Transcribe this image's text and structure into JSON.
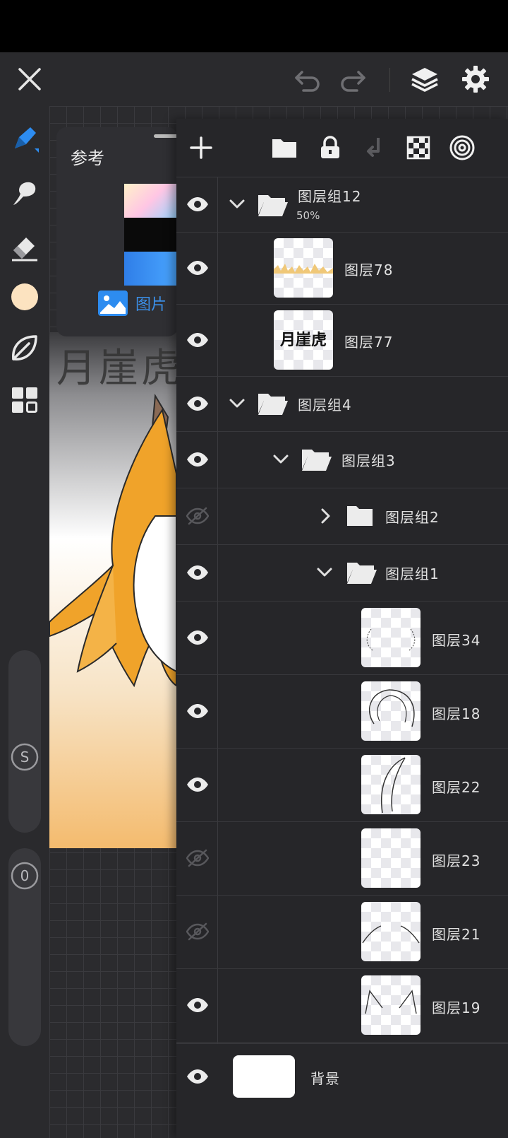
{
  "top_bar": {
    "close_icon": "close-icon",
    "undo_icon": "undo-icon",
    "redo_icon": "redo-icon",
    "layers_icon": "layers-icon",
    "settings_icon": "gear-icon"
  },
  "left_toolbar": {
    "tools": [
      "pen-icon",
      "smudge-icon",
      "eraser-icon",
      "color-swatch",
      "leaf-icon",
      "grid-icon"
    ],
    "active_color": "#FCE3C0",
    "accent_color": "#2D8CF0",
    "size_knob_label": "S",
    "opacity_knob_label": "0"
  },
  "reference_panel": {
    "title": "参考",
    "tab_label": "图片"
  },
  "canvas": {
    "title_text": "月崖虎"
  },
  "layer_toolbar": {
    "icons": [
      "add-icon",
      "folder-icon",
      "lock-icon",
      "merge-down-icon",
      "transparency-icon",
      "target-icon"
    ]
  },
  "layers": [
    {
      "name": "图层组12",
      "opacity": "50%",
      "type": "group",
      "visible": true,
      "expanded": true,
      "level": 0
    },
    {
      "name": "图层78",
      "type": "layer",
      "visible": true,
      "level": 1
    },
    {
      "name": "图层77",
      "type": "layer",
      "visible": true,
      "level": 1,
      "thumb_text": "月崖虎"
    },
    {
      "name": "图层组4",
      "type": "group",
      "visible": true,
      "expanded": true,
      "level": 0
    },
    {
      "name": "图层组3",
      "type": "group",
      "visible": true,
      "expanded": true,
      "level": 1
    },
    {
      "name": "图层组2",
      "type": "group",
      "visible": false,
      "expanded": false,
      "level": 2
    },
    {
      "name": "图层组1",
      "type": "group",
      "visible": true,
      "expanded": true,
      "level": 2
    },
    {
      "name": "图层34",
      "type": "layer",
      "visible": true,
      "level": 3
    },
    {
      "name": "图层18",
      "type": "layer",
      "visible": true,
      "level": 3
    },
    {
      "name": "图层22",
      "type": "layer",
      "visible": true,
      "level": 3
    },
    {
      "name": "图层23",
      "type": "layer",
      "visible": false,
      "level": 3
    },
    {
      "name": "图层21",
      "type": "layer",
      "visible": false,
      "level": 3
    },
    {
      "name": "图层19",
      "type": "layer",
      "visible": true,
      "level": 3
    }
  ],
  "background_layer": {
    "name": "背景",
    "color": "#FFFFFF"
  }
}
